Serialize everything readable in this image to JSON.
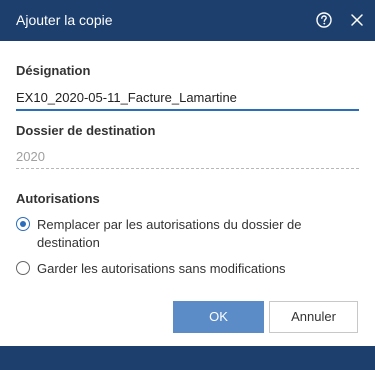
{
  "dialog": {
    "title": "Ajouter la copie",
    "help_icon": "help-circle-icon",
    "close_icon": "close-icon"
  },
  "designation": {
    "label": "Désignation",
    "value": "EX10_2020-05-11_Facture_Lamartine"
  },
  "destination": {
    "label": "Dossier de destination",
    "value": "2020"
  },
  "permissions": {
    "label": "Autorisations",
    "options": [
      {
        "label": "Remplacer par les autorisations du dossier de destination",
        "selected": true
      },
      {
        "label": "Garder les autorisations sans modifications",
        "selected": false
      }
    ]
  },
  "buttons": {
    "ok_label": "OK",
    "cancel_label": "Annuler"
  },
  "colors": {
    "header_background": "#1c3f6e",
    "accent": "#2a6ebb",
    "primary_button": "#5b8cc8"
  }
}
